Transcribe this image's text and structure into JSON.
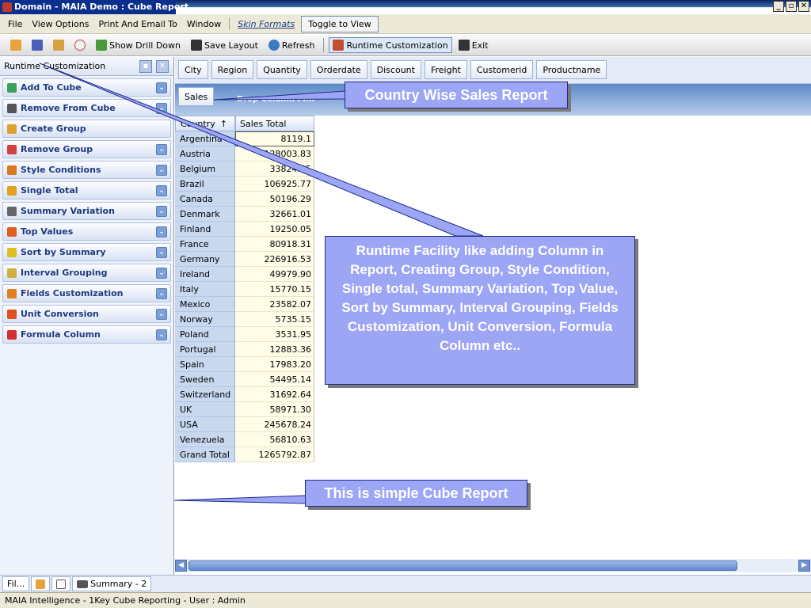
{
  "window": {
    "title": "Domain - MAIA Demo : Cube Report",
    "controls": [
      "_",
      "▫",
      "✕"
    ]
  },
  "menu": {
    "items": [
      "File",
      "View Options",
      "Print And Email To",
      "Window"
    ],
    "skin_formats": "Skin Formats",
    "toggle": "Toggle to View"
  },
  "toolbar": {
    "show_drill_down": "Show Drill Down",
    "save_layout": "Save Layout",
    "refresh": "Refresh",
    "runtime_customization": "Runtime Customization",
    "exit": "Exit"
  },
  "left_panel": {
    "title": "Runtime Customization",
    "items": [
      {
        "label": "Add To Cube",
        "icon": "add-icon",
        "color": "#3aa35a"
      },
      {
        "label": "Remove From Cube",
        "icon": "remove-icon",
        "color": "#555555"
      },
      {
        "label": "Create Group",
        "icon": "group-icon",
        "color": "#e0a030"
      },
      {
        "label": "Remove Group",
        "icon": "remove-group-icon",
        "color": "#d04040"
      },
      {
        "label": "Style Conditions",
        "icon": "style-icon",
        "color": "#d87a20"
      },
      {
        "label": "Single Total",
        "icon": "total-icon",
        "color": "#e0a020"
      },
      {
        "label": "Summary Variation",
        "icon": "summary-icon",
        "color": "#666666"
      },
      {
        "label": "Top Values",
        "icon": "top-values-icon",
        "color": "#e06020"
      },
      {
        "label": "Sort by Summary",
        "icon": "sort-icon",
        "color": "#e0c020"
      },
      {
        "label": "Interval Grouping",
        "icon": "interval-icon",
        "color": "#d0b040"
      },
      {
        "label": "Fields Customization",
        "icon": "fields-icon",
        "color": "#e08020"
      },
      {
        "label": "Unit Conversion",
        "icon": "unit-icon",
        "color": "#e05020"
      },
      {
        "label": "Formula Column",
        "icon": "sigma-icon",
        "color": "#d03030"
      }
    ]
  },
  "field_chips": [
    "City",
    "Region",
    "Quantity",
    "Orderdate",
    "Discount",
    "Freight",
    "Customerid",
    "Productname"
  ],
  "data_area": {
    "chip": "Sales",
    "drop_text": "Drop Column Fi..."
  },
  "grid": {
    "row_header": "Country",
    "sort_glyph": "↑",
    "data_header": "Sales Total",
    "rows": [
      [
        "Argentina",
        "8119.1"
      ],
      [
        "Austria",
        "128003.83"
      ],
      [
        "Belgium",
        "33824.85"
      ],
      [
        "Brazil",
        "106925.77"
      ],
      [
        "Canada",
        "50196.29"
      ],
      [
        "Denmark",
        "32661.01"
      ],
      [
        "Finland",
        "19250.05"
      ],
      [
        "France",
        "80918.31"
      ],
      [
        "Germany",
        "226916.53"
      ],
      [
        "Ireland",
        "49979.90"
      ],
      [
        "Italy",
        "15770.15"
      ],
      [
        "Mexico",
        "23582.07"
      ],
      [
        "Norway",
        "5735.15"
      ],
      [
        "Poland",
        "3531.95"
      ],
      [
        "Portugal",
        "12883.36"
      ],
      [
        "Spain",
        "17983.20"
      ],
      [
        "Sweden",
        "54495.14"
      ],
      [
        "Switzerland",
        "31692.64"
      ],
      [
        "UK",
        "58971.30"
      ],
      [
        "USA",
        "245678.24"
      ],
      [
        "Venezuela",
        "56810.63"
      ],
      [
        "Grand Total",
        "1265792.87"
      ]
    ]
  },
  "bottom_tabs": {
    "first": "Fil...",
    "summary": "Summary - 2"
  },
  "status": "MAIA Intelligence - 1Key Cube Reporting - User : Admin",
  "callouts": {
    "country": "Country Wise Sales Report",
    "runtime": "Runtime Facility like adding Column in Report, Creating Group, Style Condition, Single total, Summary Variation, Top Value, Sort by Summary, Interval Grouping, Fields Customization, Unit Conversion, Formula Column etc..",
    "simple": "This is simple Cube Report"
  }
}
